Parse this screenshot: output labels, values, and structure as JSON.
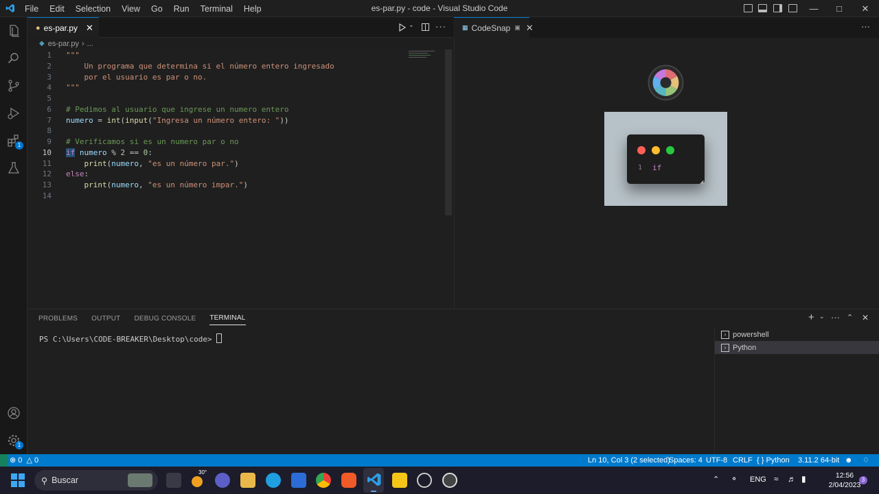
{
  "window": {
    "title": "es-par.py - code - Visual Studio Code",
    "menu": [
      "File",
      "Edit",
      "Selection",
      "View",
      "Go",
      "Run",
      "Terminal",
      "Help"
    ]
  },
  "colors": {
    "accent": "#0078d4",
    "statusbar": "#007acc"
  },
  "activity": {
    "extensions_badge": "1",
    "settings_badge": "1"
  },
  "editor": {
    "tab_label": "es-par.py",
    "breadcrumb_file": "es-par.py",
    "breadcrumb_more": "...",
    "active_line": 10,
    "lines": [
      {
        "n": "1",
        "text": "\"\"\""
      },
      {
        "n": "2",
        "text": "    Un programa que determina si el número entero ingresado"
      },
      {
        "n": "3",
        "text": "    por el usuario es par o no."
      },
      {
        "n": "4",
        "text": "\"\"\""
      },
      {
        "n": "5",
        "text": ""
      },
      {
        "n": "6",
        "text": "# Pedimos al usuario que ingrese un numero entero"
      },
      {
        "n": "7",
        "text": "numero = int(input(\"Ingresa un número entero: \"))"
      },
      {
        "n": "8",
        "text": ""
      },
      {
        "n": "9",
        "text": "# Verificamos si es un numero par o no"
      },
      {
        "n": "10",
        "text": "if numero % 2 == 0:"
      },
      {
        "n": "11",
        "text": "    print(numero, \"es un número par.\")"
      },
      {
        "n": "12",
        "text": "else:"
      },
      {
        "n": "13",
        "text": "    print(numero, \"es un número impar.\")"
      },
      {
        "n": "14",
        "text": ""
      }
    ]
  },
  "codesnap": {
    "tab_label": "CodeSnap",
    "snippet_line_number": "1",
    "snippet_code": "if"
  },
  "panel": {
    "tabs": [
      "PROBLEMS",
      "OUTPUT",
      "DEBUG CONSOLE",
      "TERMINAL"
    ],
    "active_tab": "TERMINAL",
    "prompt": "PS C:\\Users\\CODE-BREAKER\\Desktop\\code> ",
    "terminals": [
      "powershell",
      "Python"
    ]
  },
  "statusbar": {
    "errors": "0",
    "warnings": "0",
    "position": "Ln 10, Col 3 (2 selected)",
    "spaces": "Spaces: 4",
    "encoding": "UTF-8",
    "eol": "CRLF",
    "language": "Python",
    "interpreter": "3.11.2 64-bit"
  },
  "taskbar": {
    "search_placeholder": "Buscar",
    "weather": "30°",
    "language": "ENG",
    "time": "12:56",
    "date": "2/04/2023",
    "notifications": "3"
  }
}
